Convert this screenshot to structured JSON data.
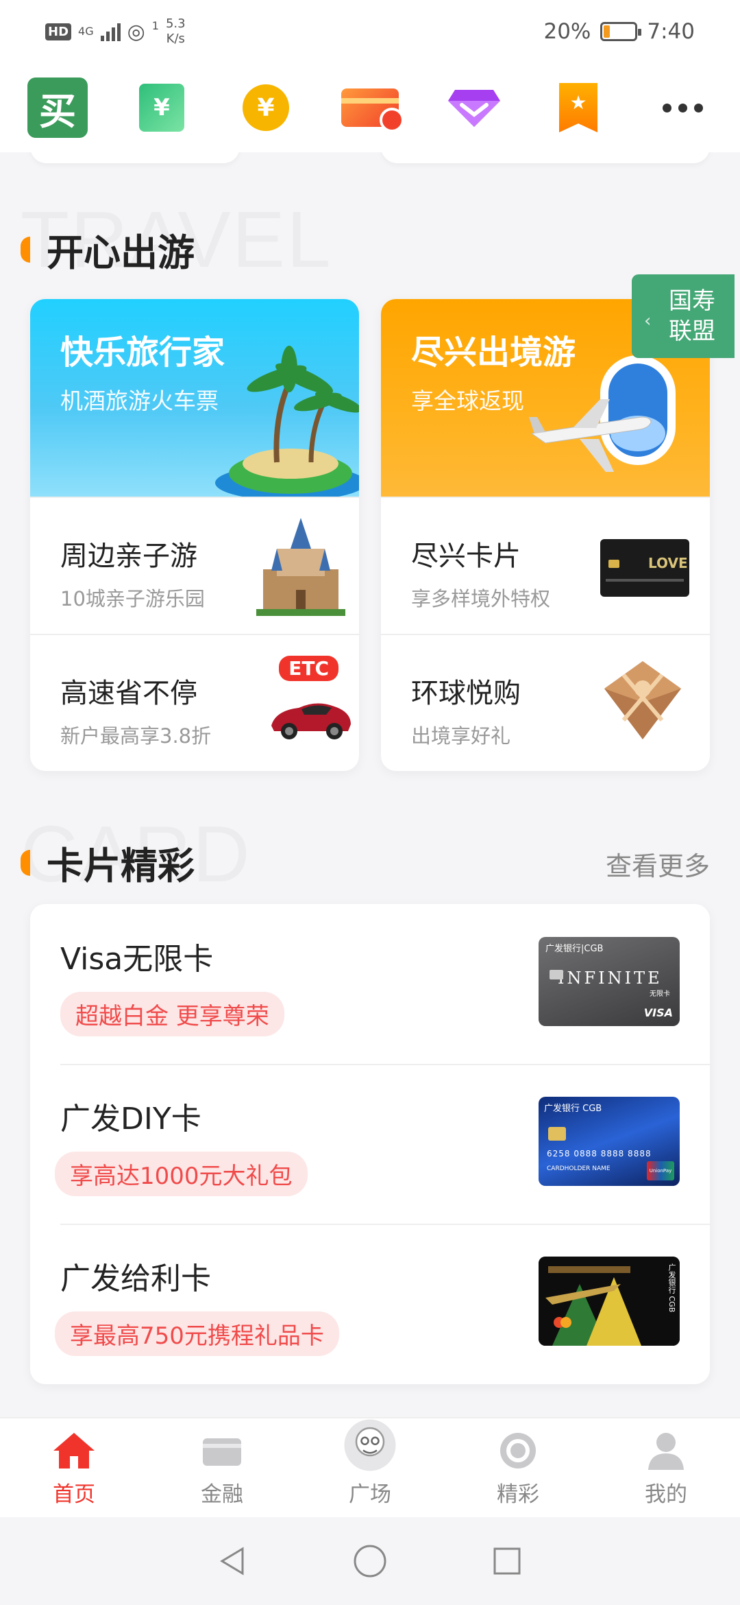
{
  "status_bar": {
    "hd": "HD",
    "network": "4G",
    "sim_index": "1",
    "speed_value": "5.3",
    "speed_unit": "K/s",
    "battery_percent": "20%",
    "battery_level": 0.2,
    "time": "7:40"
  },
  "quick_icons": [
    {
      "name": "buy-icon",
      "glyph": "买"
    },
    {
      "name": "money-icon",
      "glyph": "¥"
    },
    {
      "name": "coin-icon",
      "glyph": "¥"
    },
    {
      "name": "card-icon"
    },
    {
      "name": "gem-icon"
    },
    {
      "name": "bookmark-star-icon",
      "glyph": "★"
    },
    {
      "name": "more-icon"
    }
  ],
  "travel": {
    "bg_word": "TRAVEL",
    "title": "开心出游",
    "left_banner": {
      "title": "快乐旅行家",
      "subtitle": "机酒旅游火车票"
    },
    "right_banner": {
      "title": "尽兴出境游",
      "subtitle": "享全球返现"
    },
    "rows": [
      {
        "title": "周边亲子游",
        "subtitle": "10城亲子游乐园",
        "thumb": "castle"
      },
      {
        "title": "尽兴卡片",
        "subtitle": "享多样境外特权",
        "thumb": "card"
      },
      {
        "title": "高速省不停",
        "subtitle": "新户最高享3.8折",
        "thumb": "car",
        "badge": "ETC"
      },
      {
        "title": "环球悦购",
        "subtitle": "出境享好礼",
        "thumb": "gift"
      }
    ]
  },
  "float_badge": {
    "line1": "国寿",
    "line2": "联盟"
  },
  "cards": {
    "bg_word": "CARD",
    "title": "卡片精彩",
    "see_more": "查看更多",
    "items": [
      {
        "title": "Visa无限卡",
        "tag": "超越白金 更享尊荣",
        "card_bank": "广发银行|CGB",
        "card_text": "INFINITE",
        "card_sub": "无限卡",
        "card_brand": "VISA"
      },
      {
        "title": "广发DIY卡",
        "tag": "享高达1000元大礼包",
        "card_bank": "广发银行 CGB",
        "card_text": "6258 0888 8888 8888",
        "card_sub": "CARDHOLDER NAME",
        "card_brand": "UnionPay"
      },
      {
        "title": "广发给利卡",
        "tag": "享最高750元携程礼品卡",
        "card_bank": "广发银行 CGB",
        "card_text": "",
        "card_sub": "",
        "card_brand": ""
      }
    ]
  },
  "bottom_nav": [
    {
      "label": "首页",
      "icon": "home-icon",
      "active": true
    },
    {
      "label": "金融",
      "icon": "finance-card-icon",
      "active": false
    },
    {
      "label": "广场",
      "icon": "avatar-icon",
      "active": false
    },
    {
      "label": "精彩",
      "icon": "target-icon",
      "active": false
    },
    {
      "label": "我的",
      "icon": "profile-icon",
      "active": false
    }
  ],
  "colors": {
    "accent_red": "#f0342b",
    "section_mark": "#ff8f00",
    "tag_bg": "#fde6e6",
    "tag_text": "#f04b4b",
    "badge_green": "#44a776"
  }
}
